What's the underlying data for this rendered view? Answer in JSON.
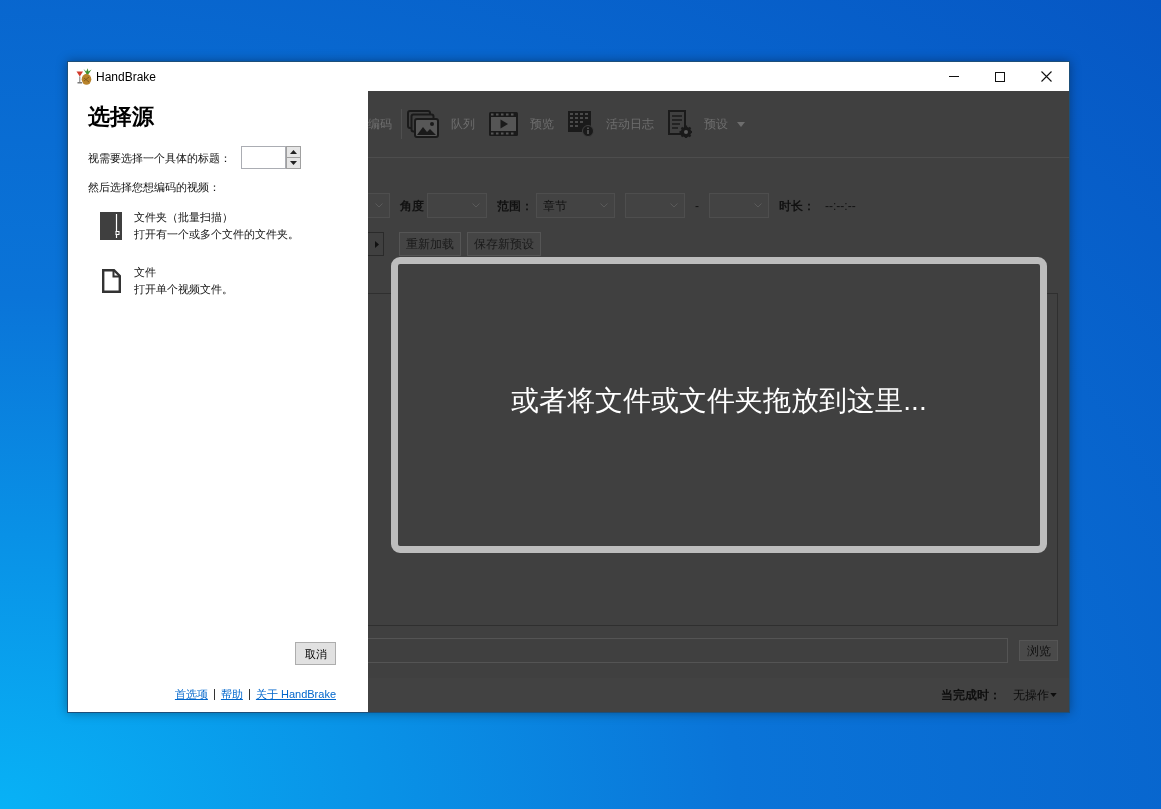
{
  "window": {
    "title": "HandBrake"
  },
  "source_panel": {
    "heading": "选择源",
    "title_label": "视需要选择一个具体的标题：",
    "prompt": "然后选择您想编码的视频：",
    "options": [
      {
        "kind": "folder",
        "title": "文件夹（批量扫描）",
        "description": "打开有一个或多个文件的文件夹。"
      },
      {
        "kind": "file",
        "title": "文件",
        "description": "打开单个视频文件。"
      }
    ],
    "cancel_button": "取消",
    "links": [
      "首选项",
      "帮助",
      "关于 HandBrake"
    ]
  },
  "toolbar": [
    {
      "kind": "encode",
      "label": "编码"
    },
    {
      "kind": "queue",
      "label": "队列"
    },
    {
      "kind": "preview",
      "label": "预览"
    },
    {
      "kind": "log",
      "label": "活动日志"
    },
    {
      "kind": "presets",
      "label": "预设"
    }
  ],
  "source_row": [
    {
      "kind": "dropdown"
    },
    {
      "kind": "label",
      "text": "角度"
    },
    {
      "kind": "dropdown"
    },
    {
      "kind": "label",
      "text": "范围："
    },
    {
      "kind": "dropdown",
      "text": "章节"
    },
    {
      "kind": "dropdown"
    },
    {
      "kind": "text",
      "text": "-"
    },
    {
      "kind": "dropdown"
    },
    {
      "kind": "label",
      "text": "时长："
    },
    {
      "kind": "text",
      "text": "--:--:--"
    }
  ],
  "preset_row": [
    {
      "kind": "arrow"
    },
    {
      "kind": "button",
      "label": "重新加载"
    },
    {
      "kind": "button",
      "label": "保存新预设"
    }
  ],
  "drop_zone": {
    "text": "或者将文件或文件夹拖放到这里..."
  },
  "destination": {
    "browse_button": "浏览"
  },
  "status_bar": {
    "when_done_label": "当完成时：",
    "when_done_value": "无操作"
  }
}
